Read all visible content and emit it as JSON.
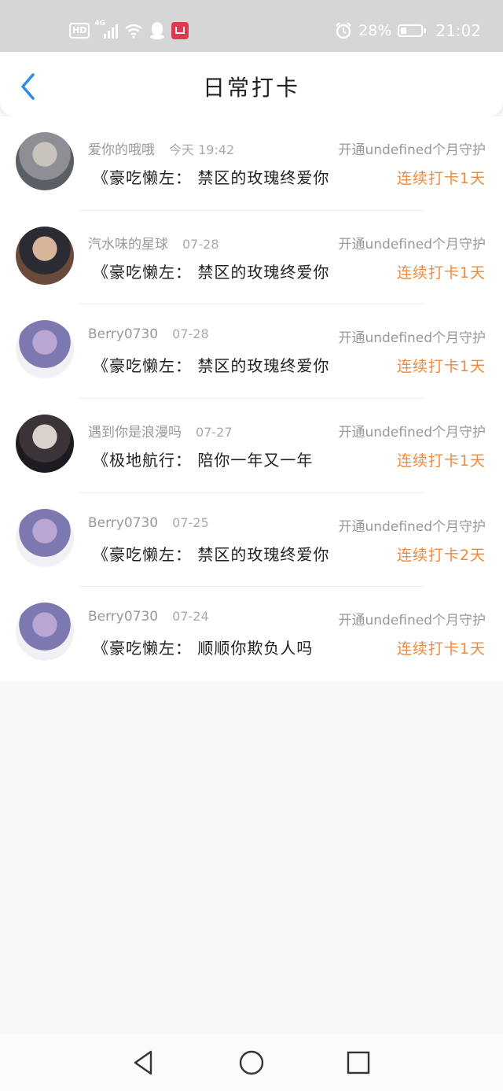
{
  "status_bar": {
    "hd": "HD",
    "network": "4G",
    "battery_text": "28%",
    "battery_level": 0.28,
    "time": "21:02"
  },
  "header": {
    "title": "日常打卡"
  },
  "items": [
    {
      "name": "爱你的哦哦",
      "time": "今天 19:42",
      "promo": "开通undefined个月守护",
      "text": "《豪吃懒左： 禁区的玫瑰终爱你",
      "streak": "连续打卡1天",
      "avatar_colors": [
        "#5a5f66",
        "#c9c3be",
        "#8d8f94"
      ]
    },
    {
      "name": "汽水味的星球",
      "time": "07-28",
      "promo": "开通undefined个月守护",
      "text": "《豪吃懒左： 禁区的玫瑰终爱你",
      "streak": "连续打卡1天",
      "avatar_colors": [
        "#6a4a3a",
        "#d8b49a",
        "#2b2b33"
      ]
    },
    {
      "name": "Berry0730",
      "time": "07-28",
      "promo": "开通undefined个月守护",
      "text": "《豪吃懒左： 禁区的玫瑰终爱你",
      "streak": "连续打卡1天",
      "avatar_colors": [
        "#f3f0f5",
        "#b9a6d2",
        "#7d78b0"
      ]
    },
    {
      "name": "遇到你是浪漫吗",
      "time": "07-27",
      "promo": "开通undefined个月守护",
      "text": "《极地航行： 陪你一年又一年",
      "streak": "连续打卡1天",
      "avatar_colors": [
        "#1d1b20",
        "#d9d2cc",
        "#3a3338"
      ]
    },
    {
      "name": "Berry0730",
      "time": "07-25",
      "promo": "开通undefined个月守护",
      "text": "《豪吃懒左： 禁区的玫瑰终爱你",
      "streak": "连续打卡2天",
      "avatar_colors": [
        "#f3f0f5",
        "#b9a6d2",
        "#7d78b0"
      ]
    },
    {
      "name": "Berry0730",
      "time": "07-24",
      "promo": "开通undefined个月守护",
      "text": "《豪吃懒左： 顺顺你欺负人吗",
      "streak": "连续打卡1天",
      "avatar_colors": [
        "#f3f0f5",
        "#b9a6d2",
        "#7d78b0"
      ]
    }
  ],
  "colors": {
    "accent_blue": "#2f8de4",
    "streak_orange": "#ef8a3c"
  }
}
